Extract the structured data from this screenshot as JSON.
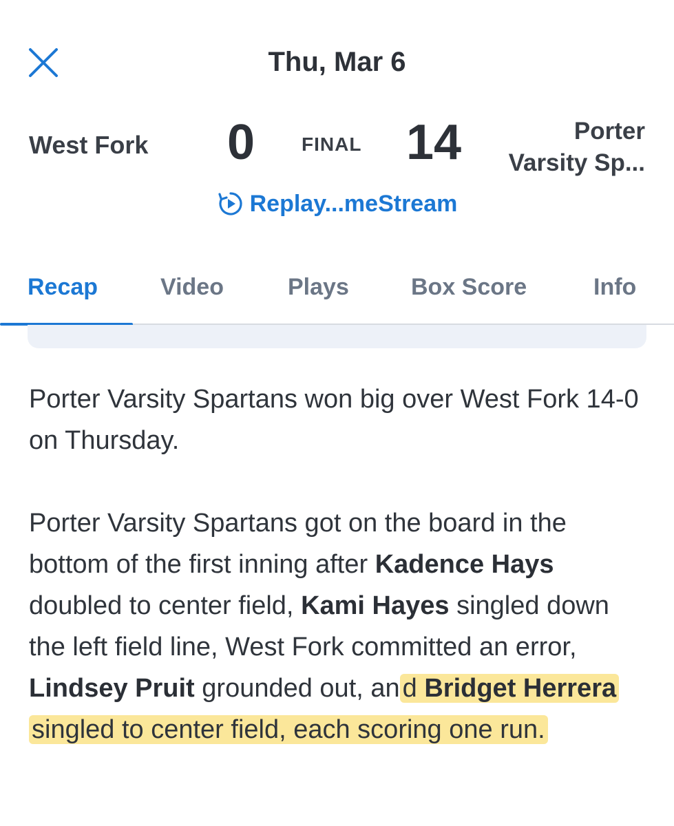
{
  "header": {
    "close_icon": "close-icon",
    "date": "Thu, Mar 6"
  },
  "game": {
    "away_team": "West Fork",
    "away_score": "0",
    "status": "FINAL",
    "home_score": "14",
    "home_team_line1": "Porter",
    "home_team_line2": "Varsity Sp...",
    "replay_label": "Replay...meStream",
    "replay_icon": "replay-icon"
  },
  "tabs": [
    {
      "label": "Recap",
      "active": true
    },
    {
      "label": "Video",
      "active": false
    },
    {
      "label": "Plays",
      "active": false
    },
    {
      "label": "Box Score",
      "active": false
    },
    {
      "label": "Info",
      "active": false
    }
  ],
  "recap": {
    "paragraph1": "Porter Varsity Spartans won big over West Fork 14-0 on Thursday.",
    "p2_part1": "Porter Varsity Spartans got on the board in the bottom of the first inning after ",
    "p2_player1": "Kadence Hays",
    "p2_part2": " doubled to center field, ",
    "p2_player2": "Kami Hayes",
    "p2_part3": " singled down the left field line, West Fork committed an error, ",
    "p2_player3": "Lindsey Pruit",
    "p2_part4": " grounded out, an",
    "p2_hl_part1": "d ",
    "p2_player4": "Bridget  Herrera",
    "p2_hl_part2": " singled to center field, each scoring one run."
  },
  "colors": {
    "accent": "#1c78d4",
    "highlight": "#fbe79a",
    "text": "#2f343b",
    "tab_inactive": "#6b7686"
  }
}
